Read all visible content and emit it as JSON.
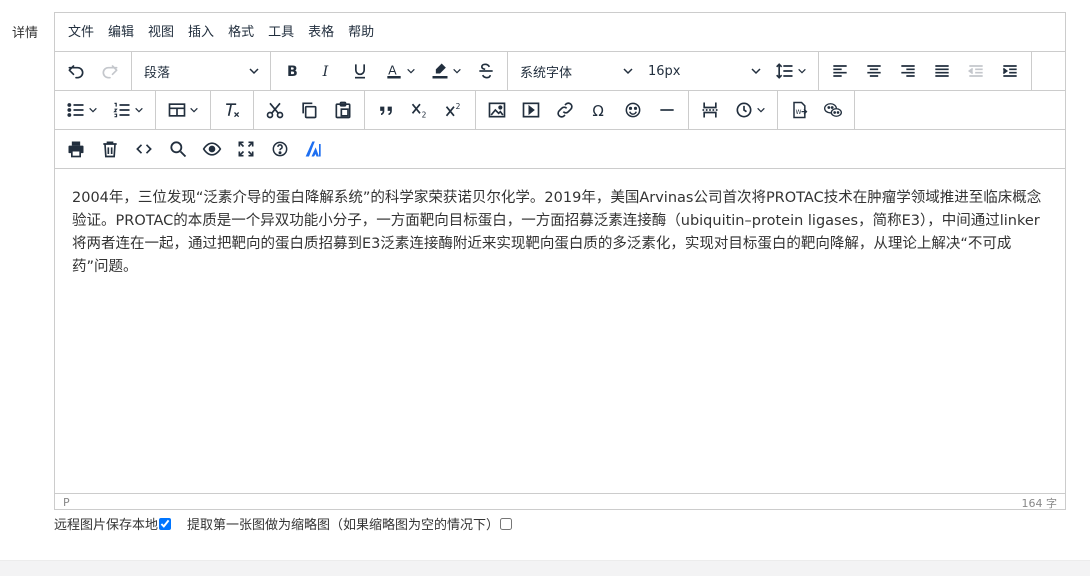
{
  "field": {
    "label": "详情"
  },
  "menubar": {
    "items": [
      "文件",
      "编辑",
      "视图",
      "插入",
      "格式",
      "工具",
      "表格",
      "帮助"
    ]
  },
  "toolbar": {
    "block_format": "段落",
    "font_family": "系统字体",
    "font_size": "16px",
    "icons": {
      "row1": [
        "undo-icon",
        "redo-icon",
        "bold-icon",
        "italic-icon",
        "underline-icon",
        "font-color-icon",
        "highlight-color-icon",
        "strikethrough-icon",
        "line-height-icon",
        "align-left-icon",
        "align-center-icon",
        "align-right-icon",
        "align-justify-icon",
        "outdent-icon",
        "indent-icon"
      ],
      "row2": [
        "bullet-list-icon",
        "numbered-list-icon",
        "table-icon",
        "clear-formatting-icon",
        "cut-icon",
        "copy-icon",
        "paste-icon",
        "blockquote-icon",
        "subscript-icon",
        "superscript-icon",
        "image-icon",
        "media-icon",
        "link-icon",
        "special-character-icon",
        "emoticons-icon",
        "horizontal-rule-icon",
        "page-break-icon",
        "insert-datetime-icon",
        "import-word-icon",
        "wechat-icon"
      ],
      "row3": [
        "print-icon",
        "delete-icon",
        "source-code-icon",
        "search-replace-icon",
        "preview-icon",
        "fullscreen-icon",
        "help-icon",
        "ai-assistant-icon"
      ]
    }
  },
  "content": {
    "paragraph": "2004年，三位发现“泛素介导的蛋白降解系统”的科学家荣获诺贝尔化学。2019年，美国Arvinas公司首次将PROTAC技术在肿瘤学领域推进至临床概念验证。PROTAC的本质是一个异双功能小分子，一方面靶向目标蛋白，一方面招募泛素连接酶（ubiquitin–protein ligases，简称E3），中间通过linker将两者连在一起，通过把靶向的蛋白质招募到E3泛素连接酶附近来实现靶向蛋白质的多泛素化，实现对目标蛋白的靶向降解，从理论上解决“不可成药”问题。"
  },
  "statusbar": {
    "path": "P",
    "word_count": "164 字"
  },
  "options": {
    "save_remote_images": {
      "label": "远程图片保存本地",
      "checked": true
    },
    "first_image_thumbnail": {
      "label": "提取第一张图做为缩略图（如果缩略图为空的情况下）",
      "checked": false
    }
  },
  "colors": {
    "accent": "#1e6ff1",
    "border": "#cccccc",
    "text": "#222f3e"
  }
}
